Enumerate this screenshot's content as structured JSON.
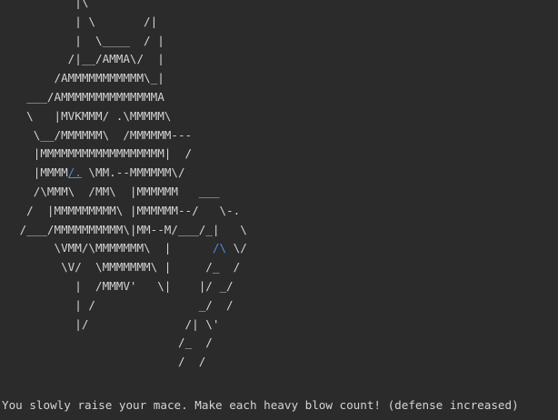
{
  "ascii_art": [
    {
      "segments": [
        {
          "text": "         |\\"
        }
      ]
    },
    {
      "segments": [
        {
          "text": "         | \\       /|"
        }
      ]
    },
    {
      "segments": [
        {
          "text": "         |  \\____  / |"
        }
      ]
    },
    {
      "segments": [
        {
          "text": "        /|__/AMMA\\/  |"
        }
      ]
    },
    {
      "segments": [
        {
          "text": "      /AMMMMMMMMMMM\\_|"
        }
      ]
    },
    {
      "segments": [
        {
          "text": "  ___/AMMMMMMMMMMMMMMA"
        }
      ]
    },
    {
      "segments": [
        {
          "text": "  \\   |MVKMMM/ .\\MMMMM\\"
        }
      ]
    },
    {
      "segments": [
        {
          "text": "   \\__/MMMMMM\\  /MMMMMM---"
        }
      ]
    },
    {
      "segments": [
        {
          "text": "   |MMMMMMMMMMMMMMMMMM|  /"
        }
      ]
    },
    {
      "segments": [
        {
          "text": "   |MMMM"
        },
        {
          "text": "/.",
          "style": "hl-underline"
        },
        {
          "text": " \\MM.--MMMMMM\\/"
        }
      ]
    },
    {
      "segments": [
        {
          "text": "   /\\MMM\\  /MM\\  |MMMMMM   ___"
        }
      ]
    },
    {
      "segments": [
        {
          "text": "  /  |MMMMMMMMM\\ |MMMMMM--/   \\-."
        }
      ]
    },
    {
      "segments": [
        {
          "text": " /___/MMMMMMMMMM\\|MM--M/___/_|   \\"
        }
      ]
    },
    {
      "segments": [
        {
          "text": "      \\VMM/\\MMMMMMM\\  |      "
        },
        {
          "text": "/\\",
          "style": "hl"
        },
        {
          "text": " \\/"
        }
      ]
    },
    {
      "segments": [
        {
          "text": "       \\V/  \\MMMMMMM\\ |     /_  /"
        }
      ]
    },
    {
      "segments": [
        {
          "text": "         |  /MMMV'   \\|    |/ _/"
        }
      ]
    },
    {
      "segments": [
        {
          "text": "         | /               _/  /"
        }
      ]
    },
    {
      "segments": [
        {
          "text": "         |/              /| \\'"
        }
      ]
    },
    {
      "segments": [
        {
          "text": "                        /_  /"
        }
      ]
    },
    {
      "segments": [
        {
          "text": "                        /  /"
        }
      ]
    }
  ],
  "status_message": "You slowly raise your mace. Make each heavy blow count! (defense increased)",
  "colors": {
    "background": "#2b2b2b",
    "foreground": "#d4d4d4",
    "highlight": "#4d8dde"
  }
}
